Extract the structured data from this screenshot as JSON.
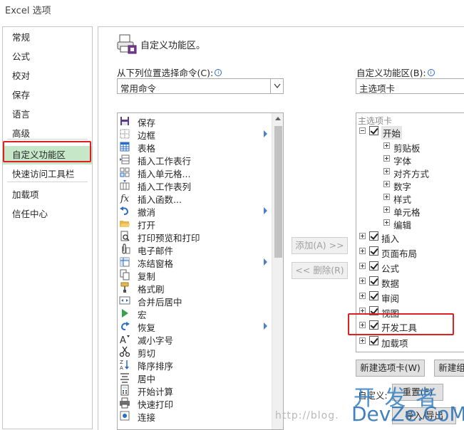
{
  "window": {
    "title": "Excel 选项"
  },
  "nav": {
    "items": [
      "常规",
      "公式",
      "校对",
      "保存",
      "语言",
      "高级",
      "自定义功能区",
      "快速访问工具栏",
      "加载项",
      "信任中心"
    ],
    "active_index": 6
  },
  "header": {
    "title": "自定义功能区。"
  },
  "left": {
    "label": "从下列位置选择命令(C):",
    "combo_value": "常用命令",
    "commands": [
      {
        "label": "保存",
        "icon": "save-icon",
        "submenu": false
      },
      {
        "label": "边框",
        "icon": "border-icon",
        "submenu": true
      },
      {
        "label": "表格",
        "icon": "table-icon",
        "submenu": false
      },
      {
        "label": "插入工作表行",
        "icon": "insert-rows-icon",
        "submenu": false
      },
      {
        "label": "插入单元格...",
        "icon": "insert-cells-icon",
        "submenu": false
      },
      {
        "label": "插入工作表列",
        "icon": "insert-columns-icon",
        "submenu": false
      },
      {
        "label": "插入函数...",
        "icon": "function-icon",
        "submenu": false
      },
      {
        "label": "撤消",
        "icon": "undo-icon",
        "submenu": true
      },
      {
        "label": "打开",
        "icon": "open-folder-icon",
        "submenu": false
      },
      {
        "label": "打印预览和打印",
        "icon": "print-preview-icon",
        "submenu": false
      },
      {
        "label": "电子邮件",
        "icon": "email-attach-icon",
        "submenu": false
      },
      {
        "label": "冻结窗格",
        "icon": "freeze-panes-icon",
        "submenu": true
      },
      {
        "label": "复制",
        "icon": "copy-icon",
        "submenu": false
      },
      {
        "label": "格式刷",
        "icon": "format-painter-icon",
        "submenu": false
      },
      {
        "label": "合并后居中",
        "icon": "merge-center-icon",
        "submenu": false
      },
      {
        "label": "宏",
        "icon": "macro-play-icon",
        "submenu": false
      },
      {
        "label": "恢复",
        "icon": "redo-icon",
        "submenu": true
      },
      {
        "label": "减小字号",
        "icon": "decrease-font-icon",
        "submenu": false
      },
      {
        "label": "剪切",
        "icon": "cut-icon",
        "submenu": false
      },
      {
        "label": "降序排序",
        "icon": "sort-desc-icon",
        "submenu": false
      },
      {
        "label": "居中",
        "icon": "center-align-icon",
        "submenu": false
      },
      {
        "label": "开始计算",
        "icon": "calculator-icon",
        "submenu": false
      },
      {
        "label": "快速打印",
        "icon": "quick-print-icon",
        "submenu": false
      },
      {
        "label": "连接",
        "icon": "connections-icon",
        "submenu": false
      }
    ]
  },
  "middle": {
    "add_button": "添加(A) >>",
    "remove_button": "<< 删除(R)"
  },
  "right": {
    "label": "自定义功能区(B):",
    "combo_value": "主选项卡",
    "tree_header": "主选项卡",
    "tree": [
      {
        "label": "开始",
        "level": 0,
        "expanded": true,
        "checked": true
      },
      {
        "label": "剪贴板",
        "level": 1,
        "expanded": false,
        "checked": false
      },
      {
        "label": "字体",
        "level": 1,
        "expanded": false,
        "checked": false
      },
      {
        "label": "对齐方式",
        "level": 1,
        "expanded": false,
        "checked": false
      },
      {
        "label": "数字",
        "level": 1,
        "expanded": false,
        "checked": false
      },
      {
        "label": "样式",
        "level": 1,
        "expanded": false,
        "checked": false
      },
      {
        "label": "单元格",
        "level": 1,
        "expanded": false,
        "checked": false
      },
      {
        "label": "编辑",
        "level": 1,
        "expanded": false,
        "checked": false
      },
      {
        "label": "插入",
        "level": 0,
        "expanded": false,
        "checked": true
      },
      {
        "label": "页面布局",
        "level": 0,
        "expanded": false,
        "checked": true
      },
      {
        "label": "公式",
        "level": 0,
        "expanded": false,
        "checked": true
      },
      {
        "label": "数据",
        "level": 0,
        "expanded": false,
        "checked": true
      },
      {
        "label": "审阅",
        "level": 0,
        "expanded": false,
        "checked": true
      },
      {
        "label": "视图",
        "level": 0,
        "expanded": false,
        "checked": true
      },
      {
        "label": "开发工具",
        "level": 0,
        "expanded": false,
        "checked": true
      },
      {
        "label": "加载项",
        "level": 0,
        "expanded": false,
        "checked": true
      }
    ],
    "new_tab_button": "新建选项卡(W)",
    "new_group_button": "新建组",
    "customize_label": "自定义:",
    "reset_button": "重置(E)",
    "import_export_button": "导入/导出"
  },
  "watermark": {
    "url": "http://blog.",
    "brand_top": "开 发 者",
    "brand_bottom": "DevZe.CoM"
  },
  "colors": {
    "highlight_red": "#e02020",
    "nav_active": "#c6e7c8"
  }
}
